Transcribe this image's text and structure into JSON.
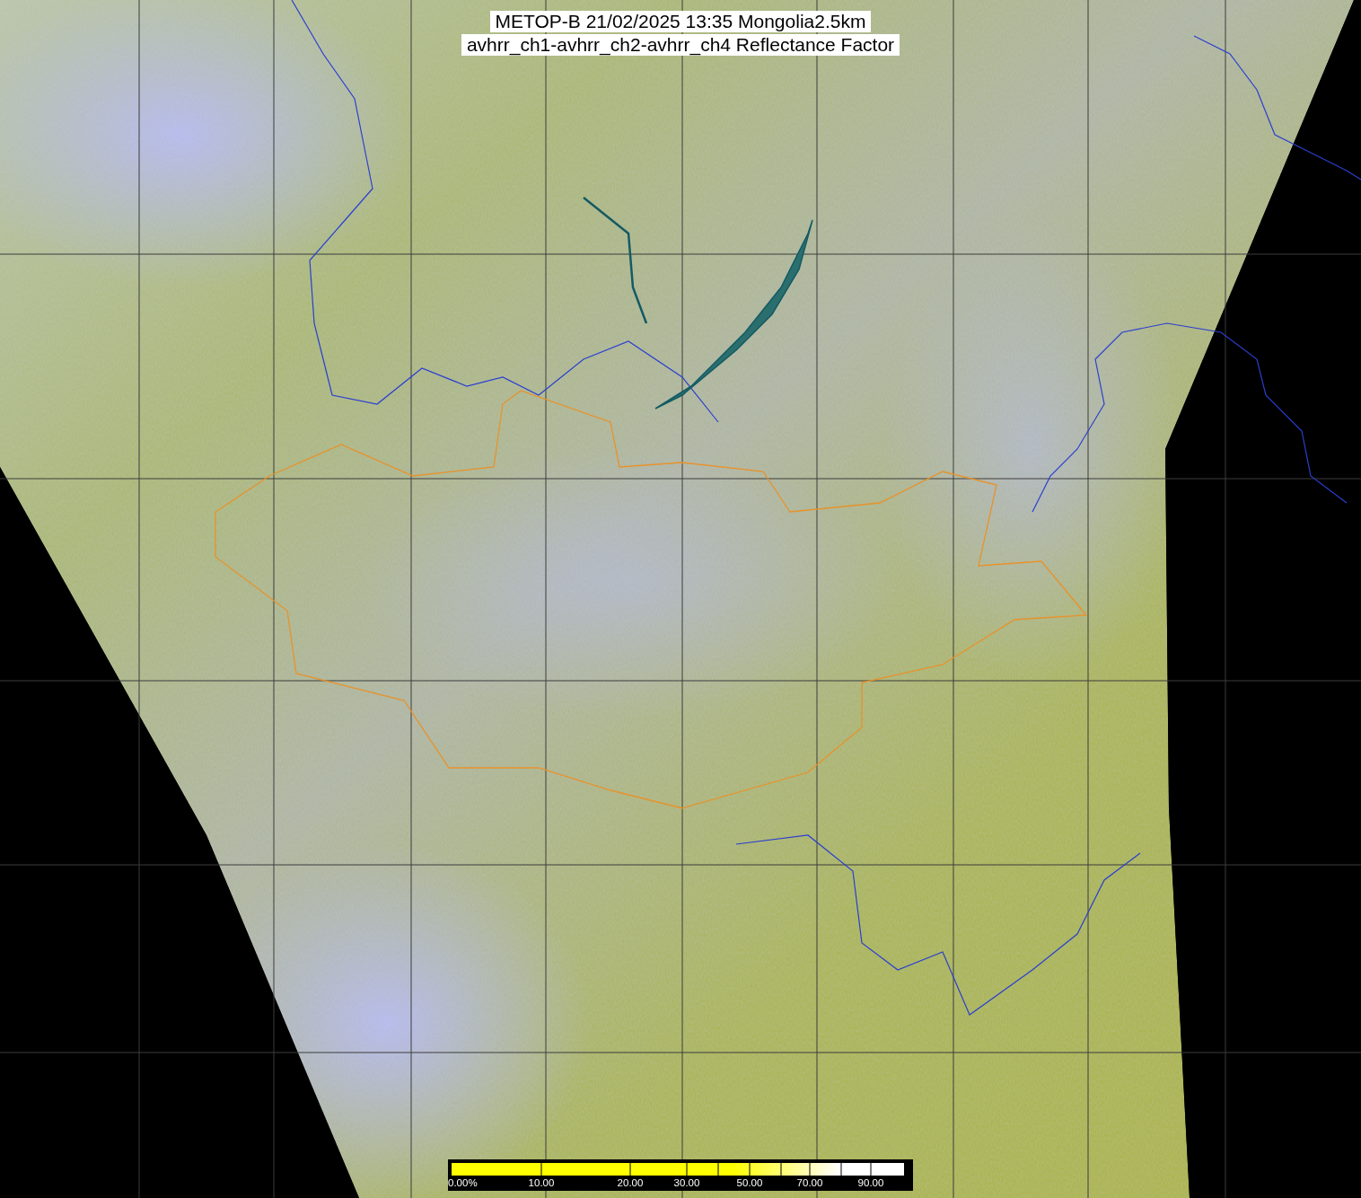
{
  "title": {
    "lines": [
      "METOP-B 21/02/2025 13:35 Mongolia2.5km",
      "avhrr_ch1-avhrr_ch2-avhrr_ch4 Reflectance Factor"
    ]
  },
  "colorbar": {
    "labels": [
      "0.00%",
      "10.00",
      "20.00",
      "30.00",
      "50.00",
      "70.00",
      "90.00"
    ]
  }
}
